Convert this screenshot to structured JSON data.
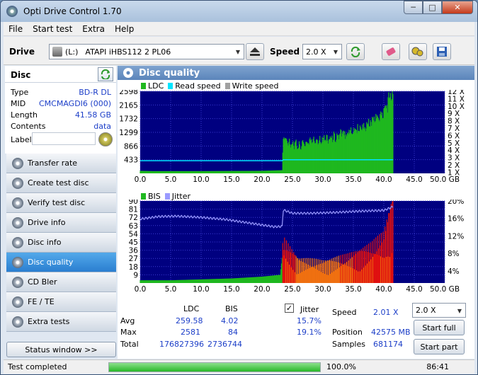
{
  "window": {
    "title": "Opti Drive Control 1.70"
  },
  "menu": [
    "File",
    "Start test",
    "Extra",
    "Help"
  ],
  "toolbar": {
    "drive_label": "Drive",
    "drive_letter": "(L:)",
    "drive_name": "ATAPI iHBS112   2 PL06",
    "speed_label": "Speed",
    "speed_value": "2.0 X"
  },
  "disc": {
    "header": "Disc",
    "rows": [
      {
        "k": "Type",
        "v": "BD-R DL"
      },
      {
        "k": "MID",
        "v": "CMCMAGDI6 (000)"
      },
      {
        "k": "Length",
        "v": "41.58 GB"
      },
      {
        "k": "Contents",
        "v": "data"
      }
    ],
    "label_key": "Label"
  },
  "nav": [
    {
      "label": "Transfer rate",
      "active": false
    },
    {
      "label": "Create test disc",
      "active": false
    },
    {
      "label": "Verify test disc",
      "active": false
    },
    {
      "label": "Drive info",
      "active": false
    },
    {
      "label": "Disc info",
      "active": false
    },
    {
      "label": "Disc quality",
      "active": true
    },
    {
      "label": "CD Bler",
      "active": false
    },
    {
      "label": "FE / TE",
      "active": false
    },
    {
      "label": "Extra tests",
      "active": false
    }
  ],
  "status_window_label": "Status window >>",
  "panel_title": "Disc quality",
  "legend_top": {
    "ldc": "LDC",
    "read": "Read speed",
    "write": "Write speed"
  },
  "legend_bottom": {
    "bis": "BIS",
    "jitter": "Jitter"
  },
  "colors": {
    "ldc": "#1fb81f",
    "read": "#00e5ff",
    "write": "#a0a0a0",
    "bis": "#1fb81f",
    "jitter": "#9a9aff",
    "plot_bg": "#000080"
  },
  "chart_data": [
    {
      "type": "area",
      "x_ticks": [
        "0.0",
        "5.0",
        "10.0",
        "15.0",
        "20.0",
        "25.0",
        "30.0",
        "35.0",
        "40.0",
        "45.0",
        "50.0 GB"
      ],
      "y_left_ticks": [
        "2598",
        "2165",
        "1732",
        "1299",
        "866",
        "433"
      ],
      "y_right_ticks": [
        "12 X",
        "11 X",
        "10 X",
        "9 X",
        "8 X",
        "7 X",
        "6 X",
        "5 X",
        "4 X",
        "3 X",
        "2 X",
        "1 X"
      ],
      "xlim": [
        0,
        50
      ],
      "ylim": [
        0,
        2598
      ],
      "series": [
        {
          "name": "LDC",
          "x": [
            0,
            2,
            5,
            10,
            15,
            20,
            23.3,
            23.5,
            24,
            26,
            28,
            30,
            32,
            34,
            36,
            38,
            40,
            41.5
          ],
          "y": [
            80,
            70,
            70,
            70,
            75,
            80,
            100,
            1100,
            1000,
            850,
            1000,
            1050,
            1100,
            1250,
            1350,
            1500,
            1800,
            2400
          ]
        },
        {
          "name": "Read speed",
          "x": [
            0,
            23.3,
            23.5,
            41.5
          ],
          "y": [
            400,
            400,
            433,
            433
          ]
        }
      ]
    },
    {
      "type": "area",
      "x_ticks": [
        "0.0",
        "5.0",
        "10.0",
        "15.0",
        "20.0",
        "25.0",
        "30.0",
        "35.0",
        "40.0",
        "45.0",
        "50.0 GB"
      ],
      "y_left_ticks": [
        "90",
        "81",
        "72",
        "63",
        "54",
        "45",
        "36",
        "27",
        "18",
        "9"
      ],
      "y_right_ticks": [
        "20%",
        "16%",
        "12%",
        "8%",
        "4%"
      ],
      "xlim": [
        0,
        50
      ],
      "ylim": [
        0,
        90
      ],
      "series": [
        {
          "name": "BIS",
          "x": [
            0,
            5,
            10,
            15,
            20,
            23,
            23.5,
            26,
            30,
            34,
            38,
            40,
            41.5
          ],
          "y": [
            3,
            3,
            4,
            5,
            7,
            9,
            40,
            22,
            20,
            25,
            35,
            45,
            80
          ]
        },
        {
          "name": "Jitter",
          "x": [
            0,
            3,
            6,
            10,
            14,
            18,
            22,
            23.3,
            23.5,
            25,
            28,
            32,
            36,
            40,
            41.5
          ],
          "y": [
            15.6,
            16.2,
            16.3,
            16.0,
            15.5,
            14.6,
            13.7,
            13.8,
            17.8,
            17.0,
            17.0,
            17.2,
            17.5,
            17.7,
            18.6
          ]
        }
      ]
    }
  ],
  "stats": {
    "col_ldc": "LDC",
    "col_bis": "BIS",
    "jitter_label": "Jitter",
    "rows": [
      {
        "label": "Avg",
        "ldc": "259.58",
        "bis": "4.02",
        "jitter": "15.7%"
      },
      {
        "label": "Max",
        "ldc": "2581",
        "bis": "84",
        "jitter": "19.1%"
      },
      {
        "label": "Total",
        "ldc": "176827396",
        "bis": "2736744",
        "jitter": ""
      }
    ],
    "speed_label": "Speed",
    "speed_value": "2.01 X",
    "speed_select": "2.0 X",
    "position_label": "Position",
    "position_value": "42575 MB",
    "samples_label": "Samples",
    "samples_value": "681174",
    "start_full": "Start full",
    "start_part": "Start part"
  },
  "statusbar": {
    "text": "Test completed",
    "progress_label": "100.0%",
    "progress": 1.0,
    "time": "86:41"
  }
}
